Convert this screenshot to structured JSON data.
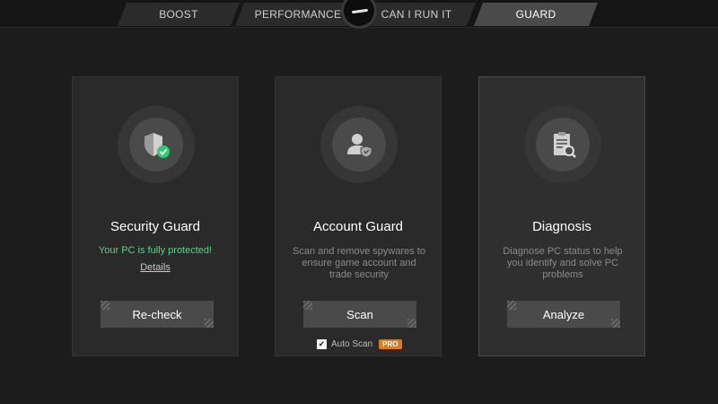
{
  "tabs": [
    {
      "label": "BOOST"
    },
    {
      "label": "PERFORMANCE"
    },
    {
      "label": "CAN I RUN IT"
    },
    {
      "label": "GUARD"
    }
  ],
  "active_tab": "GUARD",
  "colors": {
    "background": "#1c1c1c",
    "card": "#2a2a2a",
    "status_green": "#57d38c",
    "pro_badge": "#e07a21"
  },
  "cards": [
    {
      "icon": "shield-check-icon",
      "title": "Security Guard",
      "status": "Your PC is fully protected!",
      "link": "Details",
      "button": "Re-check"
    },
    {
      "icon": "user-shield-icon",
      "title": "Account Guard",
      "description": "Scan and remove spywares to ensure game account and trade security",
      "button": "Scan",
      "auto_scan": {
        "label": "Auto Scan",
        "checked": true,
        "badge": "PRO"
      }
    },
    {
      "icon": "clipboard-search-icon",
      "title": "Diagnosis",
      "description": "Diagnose PC status to help you identify and solve PC problems",
      "button": "Analyze"
    }
  ]
}
